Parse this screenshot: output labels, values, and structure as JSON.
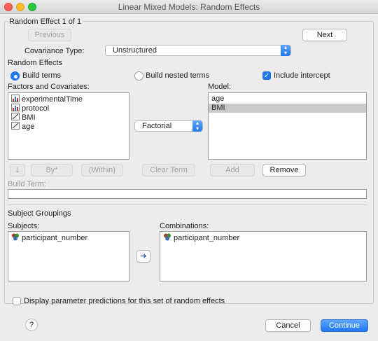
{
  "window": {
    "title": "Linear Mixed Models: Random Effects"
  },
  "random_effect": {
    "header": "Random Effect 1 of 1",
    "previous_label": "Previous",
    "next_label": "Next",
    "covariance_label": "Covariance Type:",
    "covariance_value": "Unstructured"
  },
  "random_effects": {
    "header": "Random Effects",
    "build_terms_label": "Build terms",
    "build_nested_label": "Build nested terms",
    "include_intercept_label": "Include intercept",
    "factors_label": "Factors and Covariates:",
    "factors": [
      {
        "label": "experimentalTime",
        "icon": "bar-chart-icon"
      },
      {
        "label": "protocol",
        "icon": "bar-chart-icon"
      },
      {
        "label": "BMI",
        "icon": "scale-ruler-icon"
      },
      {
        "label": "age",
        "icon": "scale-ruler-icon"
      }
    ],
    "model_label": "Model:",
    "model_items": [
      "age",
      "BMI"
    ],
    "term_type": "Factorial",
    "by_label": "By*",
    "within_label": "(Within)",
    "clear_term_label": "Clear Term",
    "add_label": "Add",
    "remove_label": "Remove",
    "build_term_label": "Build Term:"
  },
  "subject_groupings": {
    "header": "Subject Groupings",
    "subjects_label": "Subjects:",
    "subjects": [
      "participant_number"
    ],
    "combinations_label": "Combinations:",
    "combinations": [
      "participant_number"
    ]
  },
  "footer": {
    "display_predictions_label": "Display parameter predictions for this set of random effects",
    "help_label": "?",
    "cancel_label": "Cancel",
    "continue_label": "Continue"
  },
  "colors": {
    "accent": "#1f77f3",
    "selection": "#cacaca",
    "nominal_icon": "#b03a2e"
  }
}
